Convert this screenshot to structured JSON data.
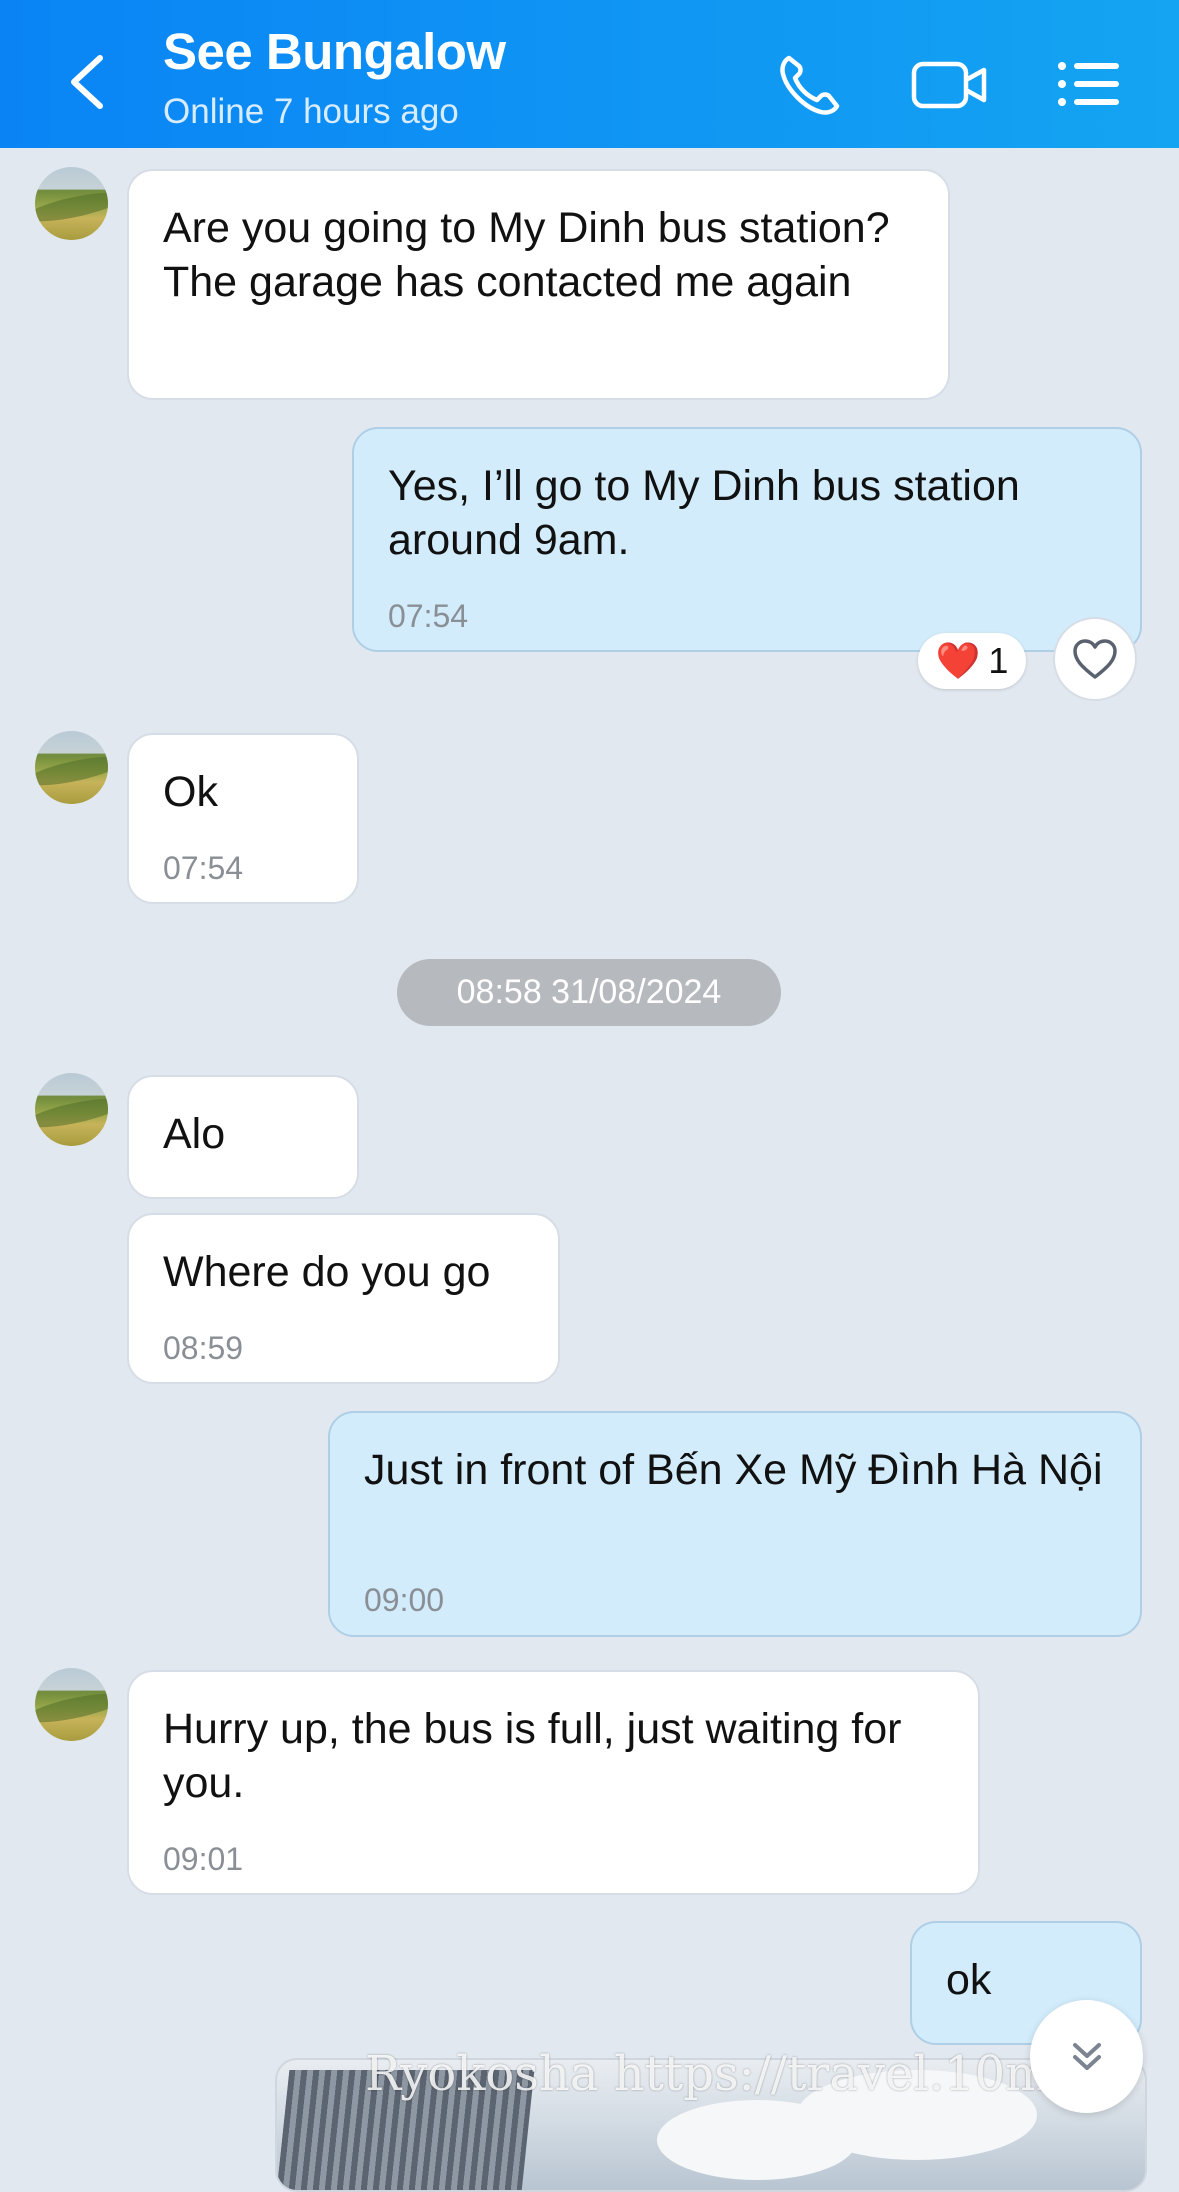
{
  "header": {
    "title": "See Bungalow",
    "status": "Online 7 hours ago",
    "colors": {
      "bar": "#0a84f5",
      "text": "#ffffff"
    },
    "icons": [
      "back-chevron-icon",
      "phone-icon",
      "video-icon",
      "menu-icon"
    ]
  },
  "messages": [
    {
      "side": "in",
      "text": "Are you going to My Dinh bus station? The garage has contacted me again",
      "time": ""
    },
    {
      "side": "out",
      "text": "Yes, I’ll go to My Dinh bus station around 9am.",
      "time": "07:54",
      "reaction": {
        "emoji": "❤️",
        "count": "1"
      }
    },
    {
      "side": "in",
      "text": "Ok",
      "time": "07:54"
    },
    {
      "side": "in",
      "text": "Alo",
      "time": ""
    },
    {
      "side": "in",
      "text": "Where do you go",
      "time": "08:59"
    },
    {
      "side": "out",
      "text": "Just in front of Bến Xe Mỹ Đình Hà Nội",
      "time": "09:00"
    },
    {
      "side": "in",
      "text": "Hurry up, the bus is full, just waiting for you.",
      "time": "09:01"
    },
    {
      "side": "out",
      "text": "ok",
      "time": ""
    }
  ],
  "date_separator": "08:58 31/08/2024",
  "watermark": "Ryokosha https://travel.10ma",
  "bubble_colors": {
    "incoming": "#ffffff",
    "outgoing": "#d2ecfb",
    "background": "#e2e8f0"
  }
}
